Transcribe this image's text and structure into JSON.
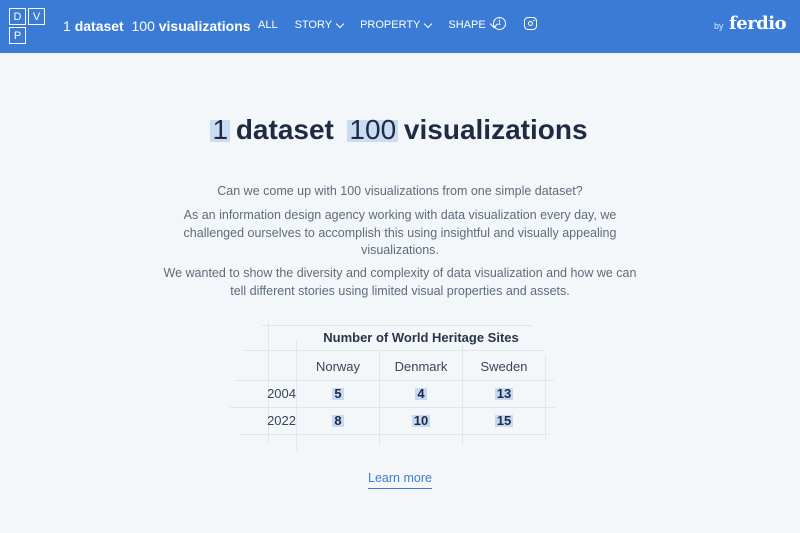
{
  "logo": {
    "letters": [
      "D",
      "V",
      "P"
    ]
  },
  "header": {
    "title_num1": "1",
    "title_word1": "dataset",
    "title_num2": "100",
    "title_word2": "visualizations",
    "nav": [
      {
        "label": "ALL",
        "dropdown": false
      },
      {
        "label": "STORY",
        "dropdown": true
      },
      {
        "label": "PROPERTY",
        "dropdown": true
      },
      {
        "label": "SHAPE",
        "dropdown": true
      }
    ],
    "by_label": "by",
    "brand": "ferdio"
  },
  "hero": {
    "num1": "1",
    "word1": "dataset",
    "num2": "100",
    "word2": "visualizations",
    "p1": "Can we come up with 100 visualizations from one simple dataset?",
    "p2": "As an information design agency working with data visualization every day, we challenged ourselves to accomplish this using insightful and visually appealing visualizations.",
    "p3": "We wanted to show the diversity and complexity of data visualization and how we can tell different stories using limited visual properties and assets."
  },
  "table": {
    "title": "Number of World Heritage Sites",
    "columns": [
      "Norway",
      "Denmark",
      "Sweden"
    ],
    "rows": [
      {
        "year": "2004",
        "values": [
          "5",
          "4",
          "13"
        ]
      },
      {
        "year": "2022",
        "values": [
          "8",
          "10",
          "15"
        ]
      }
    ]
  },
  "cta": {
    "learn_more": "Learn more"
  },
  "colors": {
    "header_bg": "#3a7bd5",
    "page_bg": "#f3f7f9",
    "highlight": "#a8c6f0",
    "text_dark": "#1f2a44"
  }
}
